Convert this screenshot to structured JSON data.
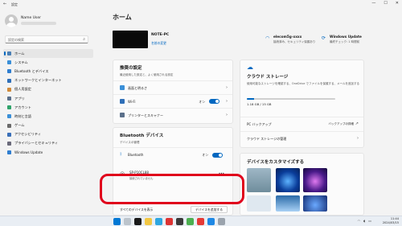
{
  "window": {
    "title": "設定",
    "back": "←",
    "min": "—",
    "max": "☐",
    "close": "✕"
  },
  "user": {
    "name": "Name User"
  },
  "search": {
    "placeholder": "設定の検索"
  },
  "sidebar": {
    "items": [
      {
        "label": "ホーム",
        "color": "#4a7fb5"
      },
      {
        "label": "システム",
        "color": "#3a8fd8"
      },
      {
        "label": "Bluetooth とデバイス",
        "color": "#2f7ed0"
      },
      {
        "label": "ネットワークとインターネット",
        "color": "#2f6fb8"
      },
      {
        "label": "個人用設定",
        "color": "#d08a3a"
      },
      {
        "label": "アプリ",
        "color": "#5a6f8a"
      },
      {
        "label": "アカウント",
        "color": "#2fa36a"
      },
      {
        "label": "時刻と言語",
        "color": "#3a8fd8"
      },
      {
        "label": "ゲーム",
        "color": "#6a6a6a"
      },
      {
        "label": "アクセシビリティ",
        "color": "#3a6fb8"
      },
      {
        "label": "プライバシーとセキュリティ",
        "color": "#6a6a7a"
      },
      {
        "label": "Windows Update",
        "color": "#2f7ed0"
      }
    ]
  },
  "main": {
    "title": "ホーム",
    "device": {
      "name": "NOTE-PC",
      "rename": "名前の変更"
    },
    "tiles": [
      {
        "title": "elecom5g-xxxx",
        "sub": "接続済み、セキュリティ保護あり",
        "icon": "wifi-icon"
      },
      {
        "title": "Windows Update",
        "sub": "最終チェック: 1 時間前",
        "icon": "update-icon"
      }
    ],
    "recommended": {
      "title": "推奨の設定",
      "sub": "最近使用した設定と、よく使用される設定",
      "rows": [
        {
          "label": "画面と明るさ",
          "color": "#3a8fd8"
        },
        {
          "label": "Wi-Fi",
          "color": "#2f6fb8",
          "state": "オン"
        },
        {
          "label": "プリンターとスキャナー",
          "color": "#5a6f8a"
        }
      ]
    },
    "bluetooth": {
      "title": "Bluetooth デバイス",
      "sub": "デバイスの管理",
      "toggle_label": "Bluetooth",
      "toggle_state": "オン",
      "device_name": "SP-P10CL88",
      "device_status": "接続されていません",
      "more": "•••",
      "all_link": "すべてのデバイスを表示",
      "add_button": "デバイスを追加する"
    },
    "cloud": {
      "title": "クラウド ストレージ",
      "desc": "使用可能なストレージを確認する、OneDrive でファイルを保護する、メールを追加する",
      "usage": "1.18 GB / 15 GB",
      "usage_fraction": 0.08,
      "backup_label": "PC バックアップ",
      "backup_link": "バックアップの詳細",
      "storage_label": "クラウド ストレージの管理"
    },
    "customize": {
      "title": "デバイスをカスタマイズする"
    }
  },
  "taskbar": {
    "time": "11:44",
    "date": "2024/03/15"
  }
}
